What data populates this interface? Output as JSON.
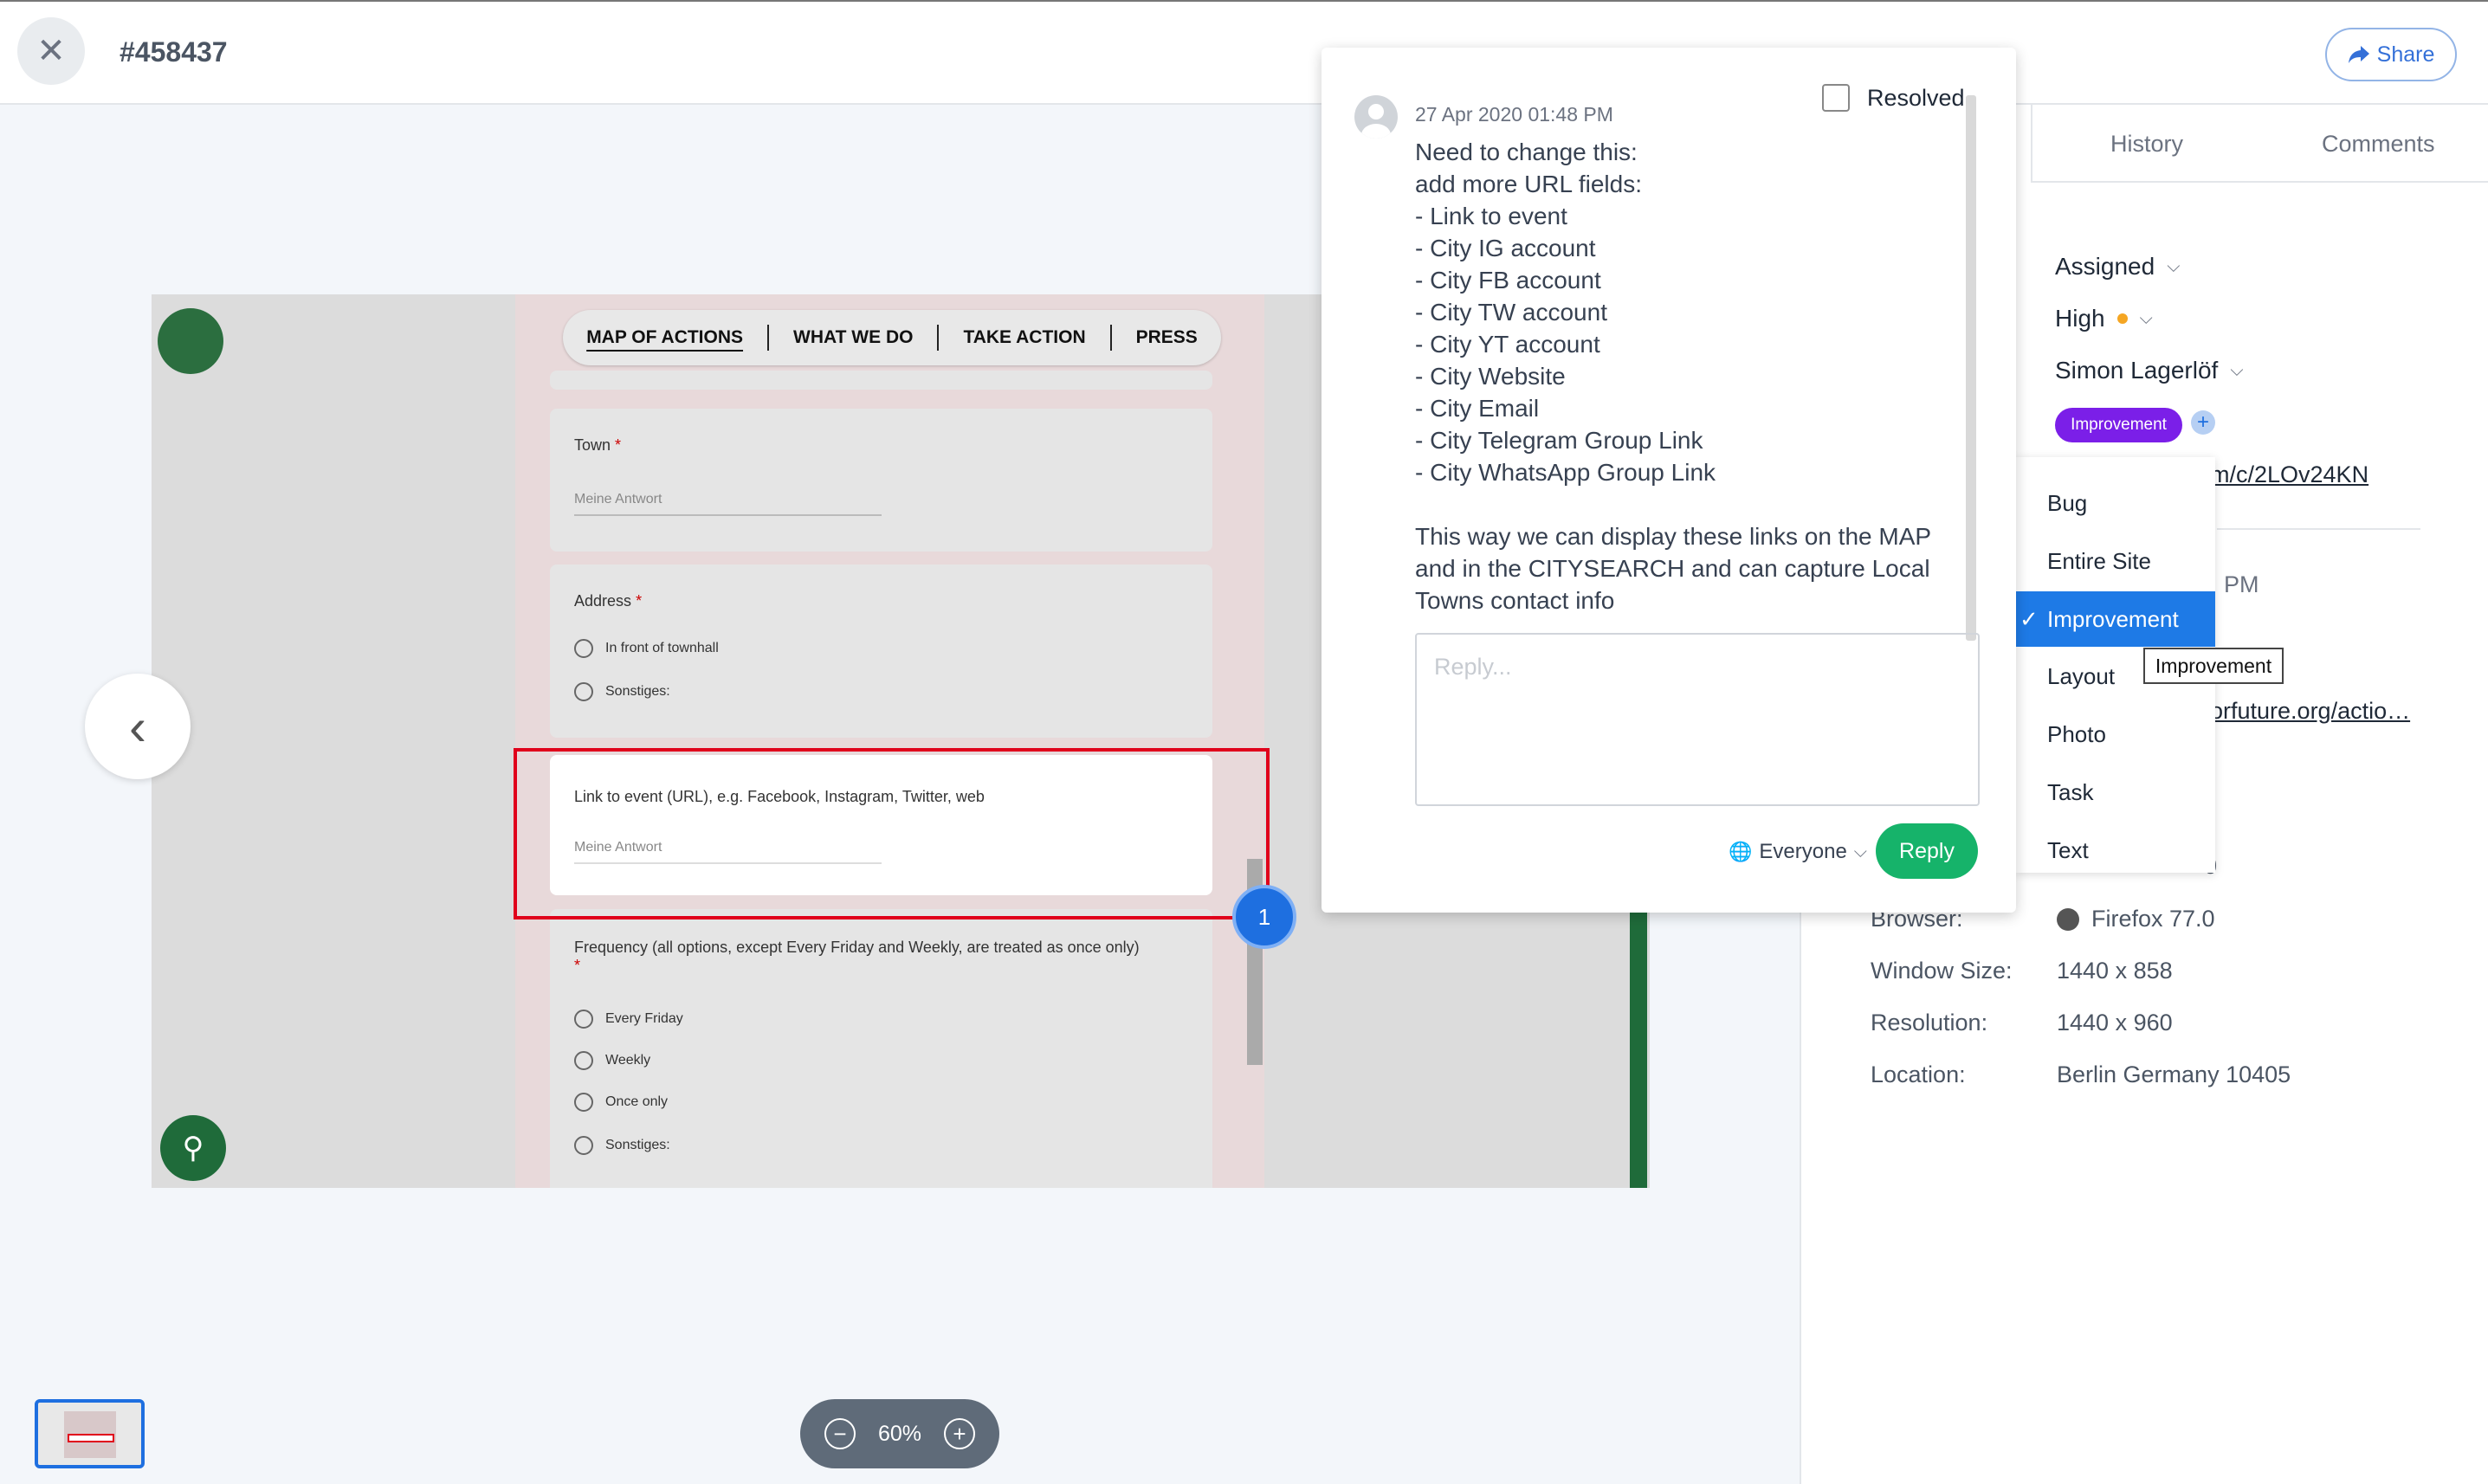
{
  "header": {
    "close_icon": "✕",
    "ticket_id": "#458437",
    "share_label": "Share"
  },
  "tabs": {
    "history": "History",
    "comments": "Comments"
  },
  "properties": {
    "status": "Assigned",
    "priority": "High",
    "priority_color": "#f5a623",
    "assignee": "Simon Lagerlöf",
    "tag": "Improvement",
    "tag_color": "#7b1fe8",
    "link_fragment": "m/c/2LOv24KN",
    "time_fragment": "PM",
    "url_fragment": "orfuture.org/actio…",
    "partial_value": "0"
  },
  "meta": [
    {
      "label": "Browser:",
      "value": "Firefox 77.0"
    },
    {
      "label": "Window Size:",
      "value": "1440 x 858"
    },
    {
      "label": "Resolution:",
      "value": "1440 x 960"
    },
    {
      "label": "Location:",
      "value": "Berlin Germany 10405"
    }
  ],
  "tag_menu": {
    "options": [
      "Bug",
      "Entire Site",
      "Improvement",
      "Layout",
      "Photo",
      "Task",
      "Text"
    ],
    "selected": "Improvement",
    "tooltip": "Improvement"
  },
  "comment": {
    "date": "27 Apr 2020 01:48 PM",
    "resolved_label": "Resolved",
    "body": "Need to change this:\nadd more URL fields:\n- Link to event\n- City IG account\n- City FB account\n- City TW account\n- City YT account\n- City Website\n- City Email\n- City Telegram Group Link\n- City WhatsApp Group Link\n\nThis way we can display these links on the MAP and in the CITYSEARCH and can capture Local Towns contact info",
    "reply_placeholder": "Reply...",
    "visibility": "Everyone",
    "reply_button": "Reply"
  },
  "preview": {
    "nav": [
      "MAP OF ACTIONS",
      "WHAT WE DO",
      "TAKE ACTION",
      "PRESS"
    ],
    "town_label": "Town",
    "town_hint": "Meine Antwort",
    "address_label": "Address",
    "address_options": [
      "In front of townhall",
      "Sonstiges:"
    ],
    "link_label": "Link to event (URL), e.g. Facebook, Instagram, Twitter, web",
    "link_hint": "Meine Antwort",
    "frequency_label": "Frequency (all options, except Every Friday and Weekly, are treated as once only)",
    "frequency_options": [
      "Every Friday",
      "Weekly",
      "Once only",
      "Sonstiges:"
    ],
    "required_mark": "*",
    "marker_number": "1"
  },
  "zoom": {
    "level": "60%"
  }
}
